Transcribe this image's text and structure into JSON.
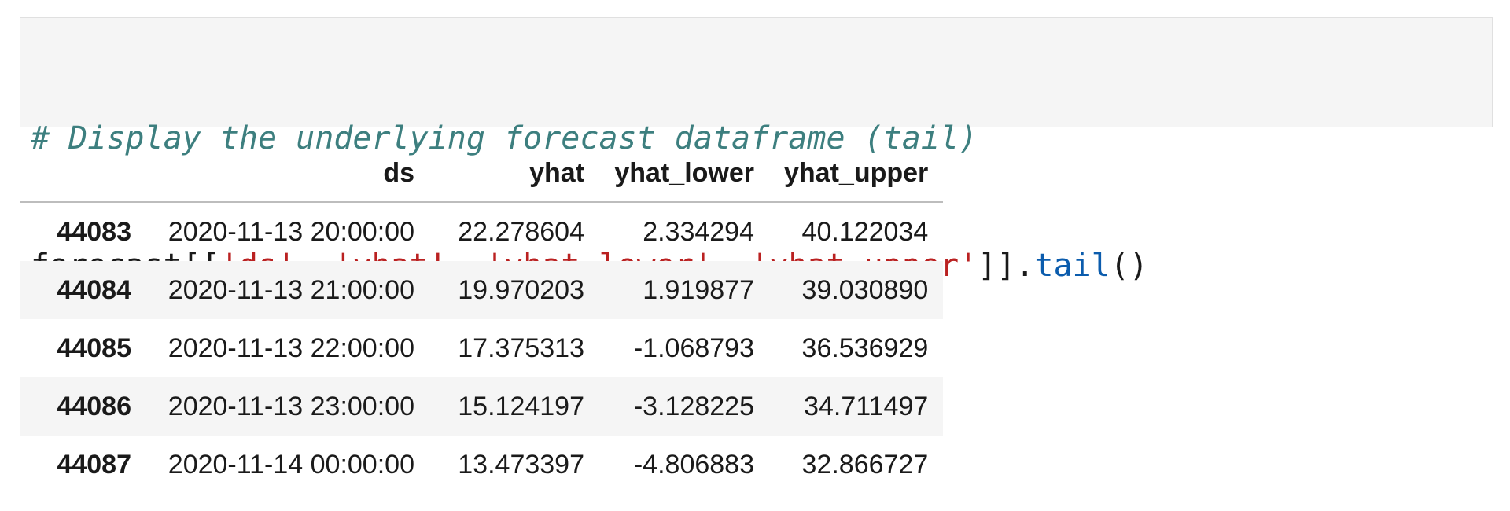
{
  "code_cell": {
    "comment": "# Display the underlying forecast dataframe (tail)",
    "code_tokens": [
      {
        "text": "forecast[[",
        "kind": "plain"
      },
      {
        "text": "'ds'",
        "kind": "string"
      },
      {
        "text": ", ",
        "kind": "plain"
      },
      {
        "text": "'yhat'",
        "kind": "string"
      },
      {
        "text": ", ",
        "kind": "plain"
      },
      {
        "text": "'yhat_lower'",
        "kind": "string"
      },
      {
        "text": ", ",
        "kind": "plain"
      },
      {
        "text": "'yhat_upper'",
        "kind": "string"
      },
      {
        "text": "]].",
        "kind": "plain"
      },
      {
        "text": "tail",
        "kind": "method"
      },
      {
        "text": "()",
        "kind": "plain"
      }
    ]
  },
  "dataframe": {
    "columns": [
      "",
      "ds",
      "yhat",
      "yhat_lower",
      "yhat_upper"
    ],
    "rows": [
      {
        "index": "44083",
        "ds": "2020-11-13 20:00:00",
        "yhat": "22.278604",
        "yhat_lower": "2.334294",
        "yhat_upper": "40.122034"
      },
      {
        "index": "44084",
        "ds": "2020-11-13 21:00:00",
        "yhat": "19.970203",
        "yhat_lower": "1.919877",
        "yhat_upper": "39.030890"
      },
      {
        "index": "44085",
        "ds": "2020-11-13 22:00:00",
        "yhat": "17.375313",
        "yhat_lower": "-1.068793",
        "yhat_upper": "36.536929"
      },
      {
        "index": "44086",
        "ds": "2020-11-13 23:00:00",
        "yhat": "15.124197",
        "yhat_lower": "-3.128225",
        "yhat_upper": "34.711497"
      },
      {
        "index": "44087",
        "ds": "2020-11-14 00:00:00",
        "yhat": "13.473397",
        "yhat_lower": "-4.806883",
        "yhat_upper": "32.866727"
      }
    ]
  },
  "colors": {
    "comment": "#3d7f7f",
    "string": "#ba2121",
    "method": "#0b5cad",
    "cell_background": "#f5f5f5"
  }
}
